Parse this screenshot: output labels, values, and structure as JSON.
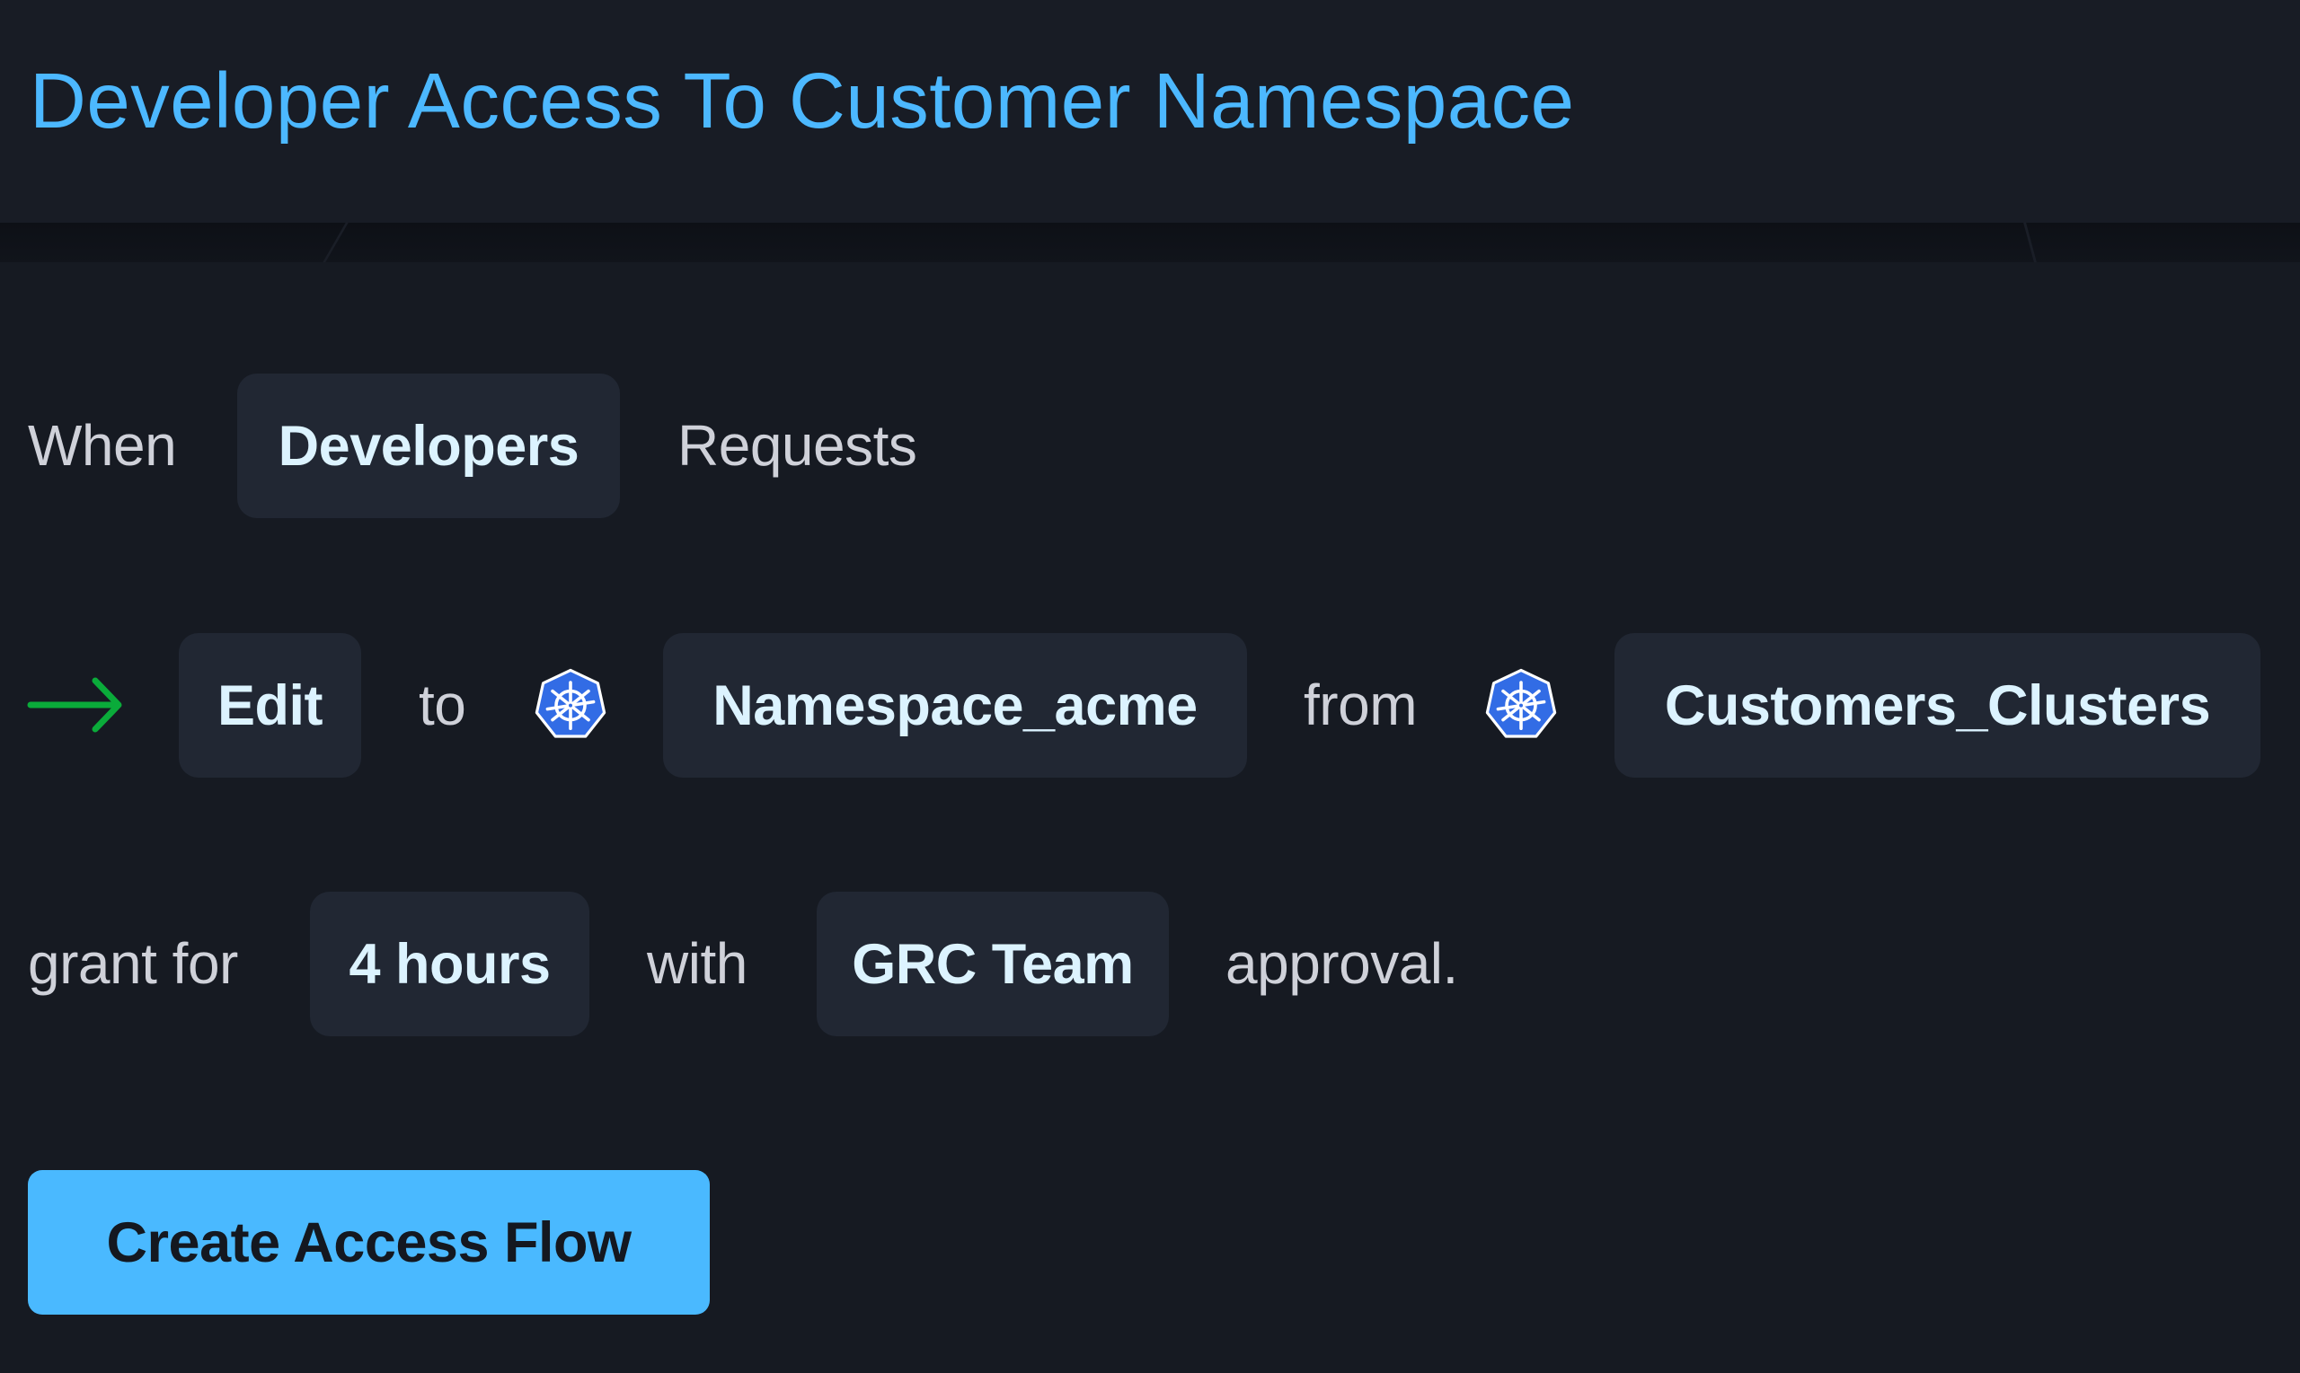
{
  "header": {
    "title": "Developer Access To Customer Namespace"
  },
  "flow": {
    "row1": {
      "when_label": "When",
      "requester": "Developers",
      "requests_label": "Requests"
    },
    "row2": {
      "arrow_icon": "arrow-right-icon",
      "permission": "Edit",
      "to_label": "to",
      "target_icon": "kubernetes-icon",
      "target": "Namespace_acme",
      "from_label": "from",
      "source_icon": "kubernetes-icon",
      "source": "Customers_Clusters"
    },
    "row3": {
      "grant_for_label": "grant for",
      "duration": "4 hours",
      "with_label": "with",
      "approver": "GRC Team",
      "approval_label": "approval."
    }
  },
  "actions": {
    "create_label": "Create Access Flow"
  },
  "colors": {
    "accent": "#4ab9ff",
    "title": "#4cb8ff",
    "arrow": "#0aab3a",
    "kubernetes": "#326ce5",
    "chip_bg": "#212733",
    "chip_text": "#dcf3ff",
    "page_bg": "#161a22",
    "header_bg": "#181c25"
  }
}
